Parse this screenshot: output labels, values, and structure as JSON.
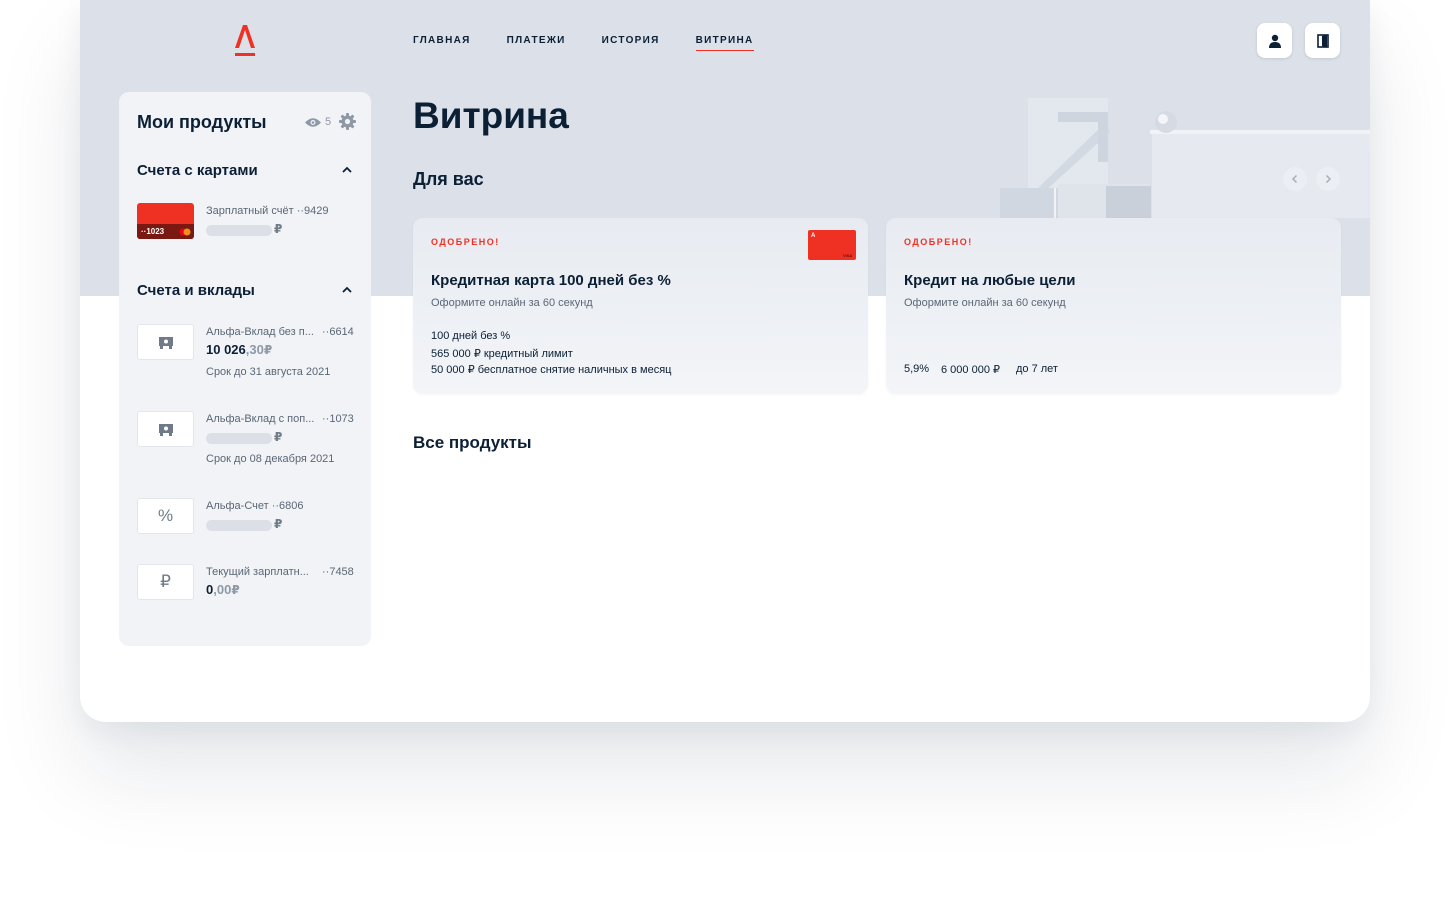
{
  "logo": {
    "icon": "alfa-a-logo",
    "color": "#ef3124"
  },
  "nav": {
    "items": [
      {
        "label": "ГЛАВНАЯ"
      },
      {
        "label": "ПЛАТЕЖИ"
      },
      {
        "label": "ИСТОРИЯ"
      },
      {
        "label": "ВИТРИНА",
        "active": true
      }
    ]
  },
  "header_buttons": [
    {
      "icon": "profile-icon"
    },
    {
      "icon": "logout-icon"
    }
  ],
  "sidebar": {
    "title": "Мои продукты",
    "hidden_count": "5",
    "sections": [
      {
        "title": "Счета с картами",
        "items": [
          {
            "name": "Зарплатный счёт",
            "number": "··9429",
            "card_number": "··1023",
            "currency": "₽"
          }
        ]
      },
      {
        "title": "Счета и вклады",
        "items": [
          {
            "name": "Альфа-Вклад без п...",
            "number": "··6614",
            "amount_int": "10 026",
            "amount_dec": ",30",
            "currency": "₽",
            "sub": "Срок до 31 августа 2021",
            "icon": "deposit-icon"
          },
          {
            "name": "Альфа-Вклад с поп...",
            "number": "··1073",
            "currency": "₽",
            "sub": "Срок до 08 декабря 2021",
            "icon": "deposit-icon"
          },
          {
            "name": "Альфа-Счет",
            "number": "··6806",
            "currency": "₽",
            "icon": "percent-icon",
            "icon_glyph": "%"
          },
          {
            "name": "Текущий зарплатн...",
            "number": "··7458",
            "amount_int": "0",
            "amount_dec": ",00",
            "currency": "₽",
            "icon": "ruble-icon",
            "icon_glyph": "₽"
          }
        ]
      }
    ]
  },
  "main": {
    "title": "Витрина",
    "for_you": "Для вас",
    "all_products": "Все продукты",
    "offers": [
      {
        "badge": "ОДОБРЕНО!",
        "title": "Кредитная карта 100 дней без %",
        "subtitle": "Оформите онлайн за 60 секунд",
        "features": [
          "100 дней без %",
          "565 000 ₽ кредитный лимит",
          "50 000 ₽ бесплатное снятие наличных в месяц"
        ],
        "image": "credit-card-image",
        "card_brand": "VISA"
      },
      {
        "badge": "ОДОБРЕНО!",
        "title": "Кредит на любые цели",
        "subtitle": "Оформите онлайн за 60 секунд",
        "stats": [
          "5,9%",
          "6 000 000 ₽",
          "до 7 лет"
        ]
      }
    ]
  },
  "colors": {
    "accent": "#ef3124",
    "text": "#0b1f35",
    "muted": "#5b6775",
    "hero_bg": "#dce1e9",
    "sidebar_bg": "#f1f3f7"
  }
}
